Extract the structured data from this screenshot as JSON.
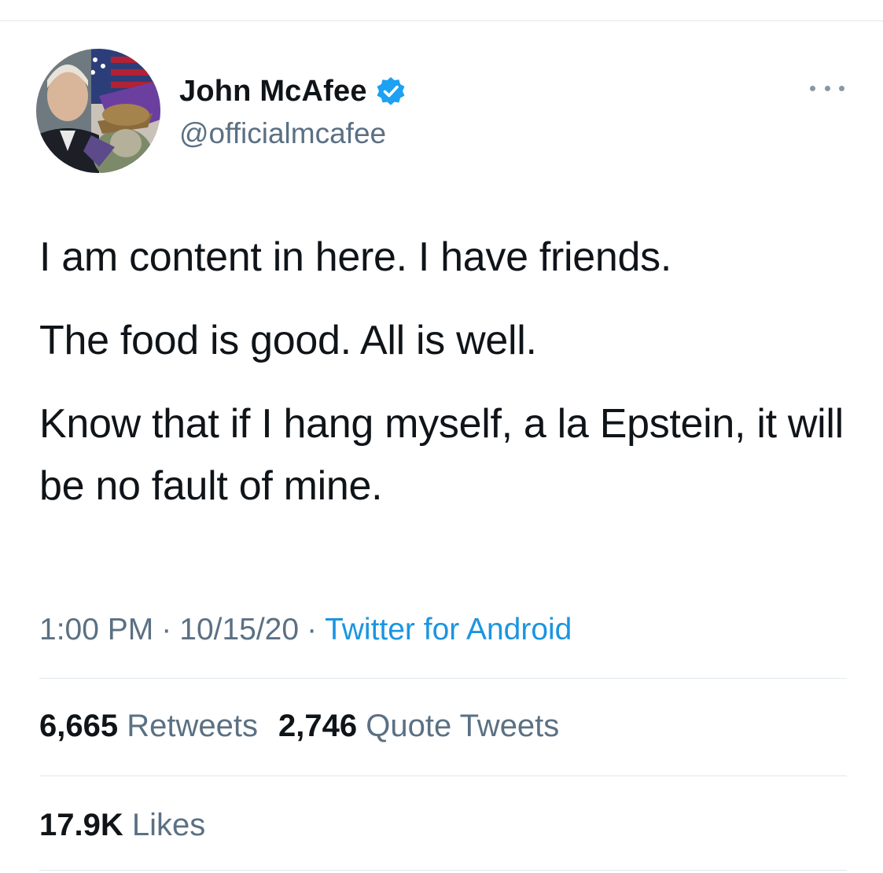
{
  "author": {
    "display_name": "John McAfee",
    "handle": "@officialmcafee",
    "verified": true,
    "avatar_icon": "profile-photo-avatar"
  },
  "tweet": {
    "paragraphs": [
      "I am content in here. I have friends.",
      "The food is good. All is well.",
      "Know that if I hang myself, a la Epstein, it will be no fault of mine."
    ]
  },
  "meta": {
    "time": "1:00 PM",
    "date": "10/15/20",
    "separator": "·",
    "source": "Twitter for Android"
  },
  "stats": {
    "retweets_count": "6,665",
    "retweets_label": "Retweets",
    "quote_count": "2,746",
    "quote_label": "Quote Tweets",
    "likes_count": "17.9K",
    "likes_label": "Likes"
  },
  "colors": {
    "text_primary": "#0f1419",
    "text_secondary": "#5b7083",
    "link": "#1b95e0",
    "verified_badge": "#1da1f2",
    "divider": "#e1e8ed"
  }
}
